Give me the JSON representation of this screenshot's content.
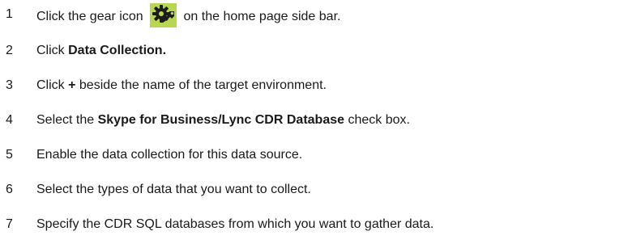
{
  "steps": [
    {
      "number": "1",
      "text_before": "Click the gear icon",
      "icon": "gear-icon",
      "icon_bg_color": "#b9d74e",
      "text_after": "on the home page side bar."
    },
    {
      "number": "2",
      "text_before": "Click ",
      "bold": "Data Collection."
    },
    {
      "number": "3",
      "text_before": "Click ",
      "bold": "+",
      "text_after": " beside the name of the target environment."
    },
    {
      "number": "4",
      "text_before": "Select the ",
      "bold": "Skype for Business/Lync CDR Database",
      "text_after": " check box."
    },
    {
      "number": "5",
      "text_before": "Enable the data collection for this data source."
    },
    {
      "number": "6",
      "text_before": "Select the types of data that you want to collect."
    },
    {
      "number": "7",
      "text_before": "Specify the CDR SQL databases from which you want to gather data."
    }
  ]
}
